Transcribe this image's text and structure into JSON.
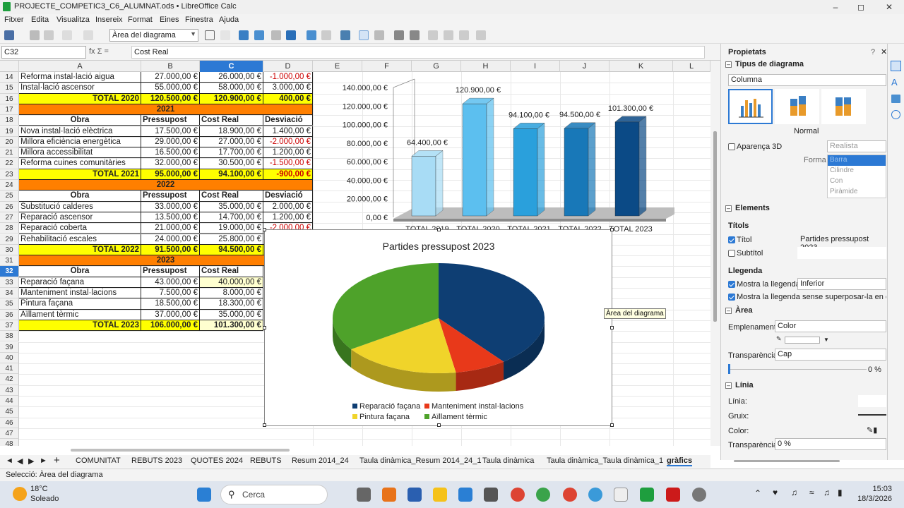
{
  "window": {
    "title": "PROJECTE_COMPETIC3_C6_ALUMNAT.ods • LibreOffice Calc"
  },
  "menu": [
    "Fitxer",
    "Edita",
    "Visualitza",
    "Insereix",
    "Format",
    "Eines",
    "Finestra",
    "Ajuda"
  ],
  "toolbar": {
    "object_select": "Àrea del diagrama"
  },
  "formula": {
    "namebox": "C32",
    "content": "Cost Real"
  },
  "columns": [
    "A",
    "B",
    "C",
    "D",
    "E",
    "F",
    "G",
    "H",
    "I",
    "J",
    "K",
    "L"
  ],
  "rows": [
    "14",
    "15",
    "16",
    "17",
    "18",
    "19",
    "20",
    "21",
    "22",
    "23",
    "24",
    "25",
    "26",
    "27",
    "28",
    "29",
    "30",
    "31",
    "32",
    "33",
    "34",
    "35",
    "36",
    "37",
    "38",
    "39",
    "40",
    "41",
    "42",
    "43",
    "44",
    "45",
    "46",
    "47",
    "48"
  ],
  "table": {
    "r14": [
      "Reforma instal·lació aigua",
      "27.000,00 €",
      "26.000,00 €",
      "-1.000,00 €"
    ],
    "r15": [
      "Instal·lació ascensor",
      "55.000,00 €",
      "58.000,00 €",
      "3.000,00 €"
    ],
    "r16": [
      "TOTAL 2020",
      "120.500,00 €",
      "120.900,00 €",
      "400,00 €"
    ],
    "r17": "2021",
    "r18": [
      "Obra",
      "Pressupost",
      "Cost Real",
      "Desviació"
    ],
    "r19": [
      "Nova instal·lació elèctrica",
      "17.500,00 €",
      "18.900,00 €",
      "1.400,00 €"
    ],
    "r20": [
      "Millora eficiència energètica",
      "29.000,00 €",
      "27.000,00 €",
      "-2.000,00 €"
    ],
    "r21": [
      "Millora accessibilitat",
      "16.500,00 €",
      "17.700,00 €",
      "1.200,00 €"
    ],
    "r22": [
      "Reforma cuines comunitàries",
      "32.000,00 €",
      "30.500,00 €",
      "-1.500,00 €"
    ],
    "r23": [
      "TOTAL 2021",
      "95.000,00 €",
      "94.100,00 €",
      "-900,00 €"
    ],
    "r24": "2022",
    "r25": [
      "Obra",
      "Pressupost",
      "Cost Real",
      "Desviació"
    ],
    "r26": [
      "Substitució calderes",
      "33.000,00 €",
      "35.000,00 €",
      "2.000,00 €"
    ],
    "r27": [
      "Reparació ascensor",
      "13.500,00 €",
      "14.700,00 €",
      "1.200,00 €"
    ],
    "r28": [
      "Reparació coberta",
      "21.000,00 €",
      "19.000,00 €",
      "-2.000,00 €"
    ],
    "r29": [
      "Rehabilitació escales",
      "24.000,00 €",
      "25.800,00 €",
      ""
    ],
    "r30": [
      "TOTAL 2022",
      "91.500,00 €",
      "94.500,00 €",
      ""
    ],
    "r31": "2023",
    "r32": [
      "Obra",
      "Pressupost",
      "Cost Real"
    ],
    "r33": [
      "Reparació façana",
      "43.000,00 €",
      "40.000,00 €"
    ],
    "r34": [
      "Manteniment instal·lacions",
      "7.500,00 €",
      "8.000,00 €"
    ],
    "r35": [
      "Pintura façana",
      "18.500,00 €",
      "18.300,00 €"
    ],
    "r36": [
      "Aïllament tèrmic",
      "37.000,00 €",
      "35.000,00 €"
    ],
    "r37": [
      "TOTAL 2023",
      "106.000,00 €",
      "101.300,00 €"
    ]
  },
  "chart_data": [
    {
      "type": "bar",
      "categories": [
        "TOTAL 2019",
        "TOTAL 2020",
        "TOTAL 2021",
        "TOTAL 2022",
        "TOTAL 2023"
      ],
      "values": [
        64400,
        120900,
        94100,
        94500,
        101300
      ],
      "labels": [
        "64.400,00 €",
        "120.900,00 €",
        "94.100,00 €",
        "94.500,00 €",
        "101.300,00 €"
      ],
      "yticks": [
        "0,00 €",
        "20.000,00 €",
        "40.000,00 €",
        "60.000,00 €",
        "80.000,00 €",
        "100.000,00 €",
        "120.000,00 €",
        "140.000,00 €"
      ],
      "ylim": [
        0,
        140000
      ],
      "colors": [
        "#a8dcf5",
        "#5cbfef",
        "#2aa0dc",
        "#1878b8",
        "#0b4a86"
      ]
    },
    {
      "type": "pie",
      "title": "Partides pressupost 2023",
      "categories": [
        "Reparació façana",
        "Manteniment instal·lacions",
        "Pintura façana",
        "Aïllament tèrmic"
      ],
      "values": [
        40000,
        8000,
        18300,
        35000
      ],
      "colors": [
        "#0e3e73",
        "#e8391a",
        "#f0d42a",
        "#4ea22a"
      ],
      "legend": "bottom"
    }
  ],
  "tooltip": "Àrea del diagrama",
  "sidebar": {
    "title": "Propietats",
    "chart_type_section": "Tipus de diagrama",
    "chart_type": "Columna",
    "variant": "Normal",
    "appearance_3d": "Aparença 3D",
    "appearance_value": "Realista",
    "shape_label": "Forma",
    "shapes": [
      "Barra",
      "Cilindre",
      "Con",
      "Piràmide"
    ],
    "elements_section": "Elements",
    "titles_label": "Títols",
    "title_check": "Títol",
    "title_value": "Partides pressupost 2023",
    "subtitle_check": "Subtítol",
    "legend_label": "Llegenda",
    "show_legend": "Mostra la llegenda",
    "legend_position": "Inferior",
    "no_overlap": "Mostra la llegenda sense superposar-la en el",
    "area_section": "Àrea",
    "fill_label": "Emplenament:",
    "fill_value": "Color",
    "transparency_label": "Transparència:",
    "transparency_value": "Cap",
    "transparency_pct": "0 %",
    "line_section": "Línia",
    "line_label": "Línia:",
    "width_label": "Gruix:",
    "color_label": "Color:",
    "line_transparency_label": "Transparència:",
    "line_transparency_value": "0 %"
  },
  "tabs": [
    "COMUNITAT",
    "REBUTS 2023",
    "QUOTES 2024",
    "REBUTS",
    "Resum 2014_24",
    "Taula dinàmica_Resum 2014_24_1",
    "Taula dinàmica",
    "Taula dinàmica_Taula dinàmica_1",
    "gràfics"
  ],
  "status": "Selecció: Àrea del diagrama",
  "taskbar": {
    "temp": "18°C",
    "weather": "Soleado",
    "search": "Cerca",
    "time": "15:03",
    "date": "18/3/2026"
  }
}
